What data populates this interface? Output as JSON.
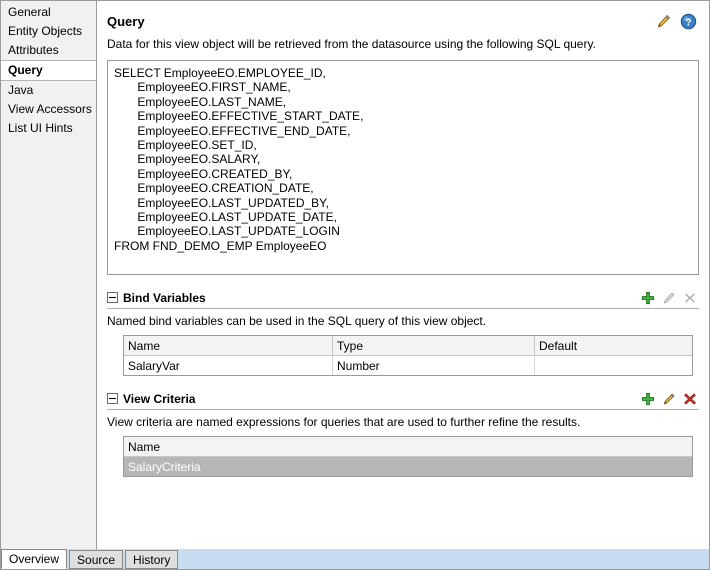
{
  "sidebar": {
    "items": [
      {
        "label": "General",
        "selected": false
      },
      {
        "label": "Entity Objects",
        "selected": false
      },
      {
        "label": "Attributes",
        "selected": false
      },
      {
        "label": "Query",
        "selected": true
      },
      {
        "label": "Java",
        "selected": false
      },
      {
        "label": "View Accessors",
        "selected": false
      },
      {
        "label": "List UI Hints",
        "selected": false
      }
    ]
  },
  "header": {
    "title": "Query",
    "edit_icon": "pencil-icon",
    "help_icon": "help-icon"
  },
  "query": {
    "description": "Data for this view object will be retrieved from the datasource using the following SQL query.",
    "sql": "SELECT EmployeeEO.EMPLOYEE_ID,\n       EmployeeEO.FIRST_NAME,\n       EmployeeEO.LAST_NAME,\n       EmployeeEO.EFFECTIVE_START_DATE,\n       EmployeeEO.EFFECTIVE_END_DATE,\n       EmployeeEO.SET_ID,\n       EmployeeEO.SALARY,\n       EmployeeEO.CREATED_BY,\n       EmployeeEO.CREATION_DATE,\n       EmployeeEO.LAST_UPDATED_BY,\n       EmployeeEO.LAST_UPDATE_DATE,\n       EmployeeEO.LAST_UPDATE_LOGIN\nFROM FND_DEMO_EMP EmployeeEO"
  },
  "bind_variables": {
    "title": "Bind Variables",
    "description": "Named bind variables can be used in the SQL query of this view object.",
    "actions": {
      "add": "add-icon",
      "edit": "pencil-icon",
      "delete": "delete-icon"
    },
    "columns": [
      "Name",
      "Type",
      "Default"
    ],
    "rows": [
      {
        "cells": [
          "SalaryVar",
          "Number",
          ""
        ],
        "selected": false
      }
    ]
  },
  "view_criteria": {
    "title": "View Criteria",
    "description": "View criteria are named expressions for queries that are used to further refine the results.",
    "actions": {
      "add": "add-icon",
      "edit": "pencil-icon",
      "delete": "delete-icon"
    },
    "columns": [
      "Name"
    ],
    "rows": [
      {
        "cells": [
          "SalaryCriteria"
        ],
        "selected": true
      }
    ]
  },
  "bottom_tabs": [
    {
      "label": "Overview",
      "active": true
    },
    {
      "label": "Source",
      "active": false
    },
    {
      "label": "History",
      "active": false
    }
  ],
  "colors": {
    "accent_blue": "#c7dcf0",
    "add_green": "#3ba93b",
    "pencil_orange": "#e8a33d",
    "delete_red": "#cc2020",
    "disabled_gray": "#9a9a9a",
    "selection_gray": "#b6b6b6"
  }
}
